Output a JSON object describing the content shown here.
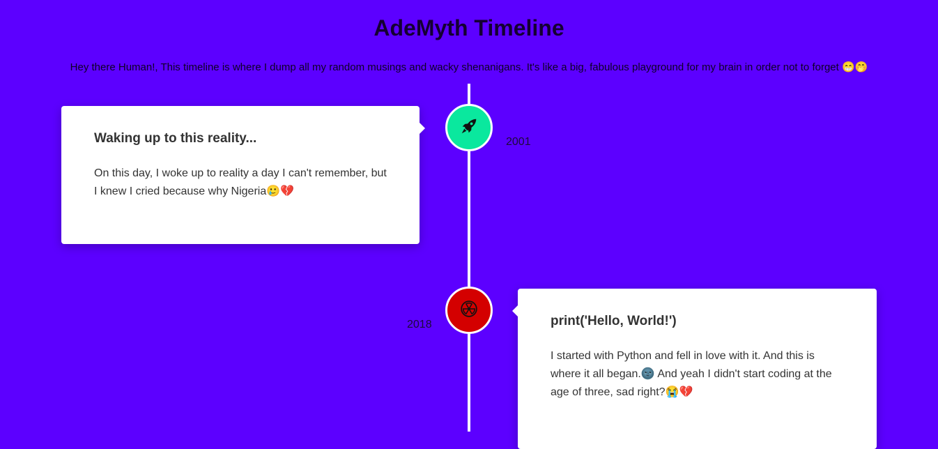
{
  "header": {
    "title": "AdeMyth Timeline",
    "intro": "Hey there Human!, This timeline is where I dump all my random musings and wacky shenanigans. It's like a big, fabulous playground for my brain in order not to forget 😁🤭"
  },
  "colors": {
    "background": "#5c00ff",
    "node_green": "#0ae89e",
    "node_red": "#d40000",
    "line": "#ffffff",
    "card": "#ffffff"
  },
  "timeline": [
    {
      "year": "2001",
      "icon": "rocket-icon",
      "title": "Waking up to this reality...",
      "text": "On this day, I woke up to reality a day I can't remember, but I knew I cried because why Nigeria🥲💔"
    },
    {
      "year": "2018",
      "icon": "radiation-icon",
      "title": "print('Hello, World!')",
      "text": "I started with Python and fell in love with it. And this is where it all began.🌚 And yeah I didn't start coding at the age of three, sad right?😭💔"
    }
  ]
}
